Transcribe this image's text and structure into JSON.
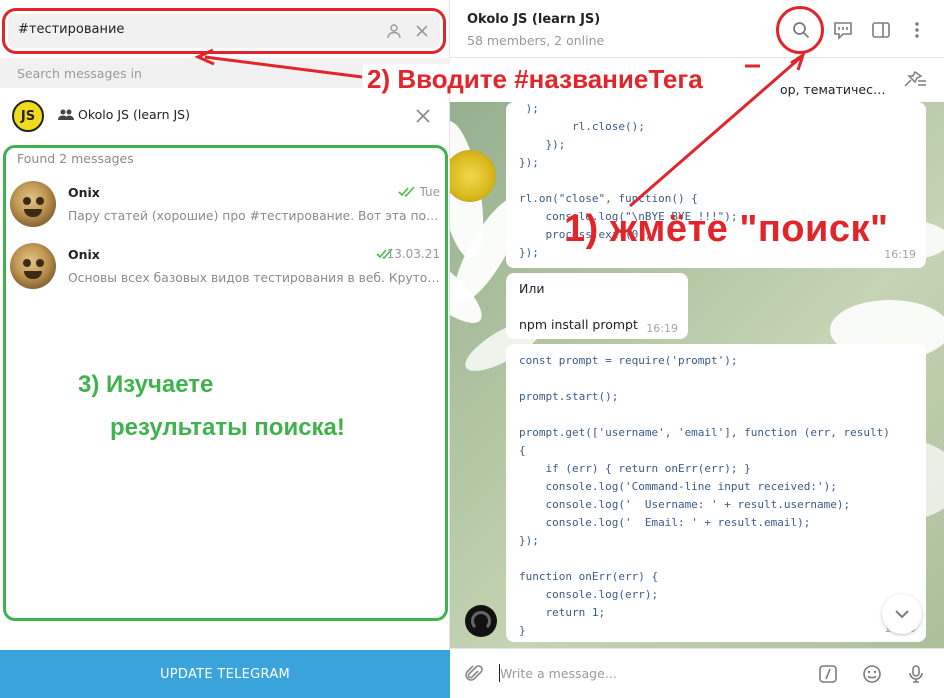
{
  "search": {
    "value": "#тестирование",
    "in_placeholder": "Search messages in"
  },
  "chat": {
    "title": "Okolo JS (learn JS)",
    "subtitle": "58 members, 2 online",
    "logo_text": "JS"
  },
  "results": {
    "found_label": "Found 2 messages",
    "items": [
      {
        "name": "Onix",
        "date": "Tue",
        "text": "Пару статей (хорошие) про #тестирование.  Вот эта попро…"
      },
      {
        "name": "Onix",
        "date": "13.03.21",
        "text": "Основы всех базовых видов тестирования в веб. Крутой п…"
      }
    ]
  },
  "update_button": "UPDATE TELEGRAM",
  "pinned_text": "ор, тематичес…",
  "messages": {
    "code1": {
      "text": " );\n        rl.close();\n    });\n});\n\nrl.on(\"close\", function() {\n    console.log(\"\\nBYE BYE !!!\");\n    process.exit(0);\n});",
      "time": "16:19"
    },
    "plain": {
      "line1": "Или",
      "line2": "npm install prompt",
      "time": "16:19"
    },
    "code2": {
      "text": "const prompt = require('prompt');\n\nprompt.start();\n\nprompt.get(['username', 'email'], function (err, result)\n{\n    if (err) { return onErr(err); }\n    console.log('Command-line input received:');\n    console.log('  Username: ' + result.username);\n    console.log('  Email: ' + result.email);\n});\n\nfunction onErr(err) {\n    console.log(err);\n    return 1;\n}",
      "time": "16:19"
    }
  },
  "composer": {
    "placeholder": "Write a message..."
  },
  "annotations": {
    "step1": "1) жмёте \"поиск\"",
    "step2": "2) Вводите #названиеТега",
    "step3_line1": "3) Изучаете",
    "step3_line2": "результаты поиска!"
  },
  "colors": {
    "accent": "#3ba4dd",
    "annotation_red": "#e2252b",
    "annotation_green": "#3fb24d",
    "ticks": "#4dba4d"
  },
  "icons": [
    "contact-icon",
    "close-icon",
    "group-icon",
    "double-check-icon",
    "search-icon",
    "comment-icon",
    "sidebar-toggle-icon",
    "more-icon",
    "pin-off-icon",
    "chevron-down-icon",
    "paperclip-icon",
    "command-icon",
    "emoji-icon",
    "microphone-icon"
  ]
}
